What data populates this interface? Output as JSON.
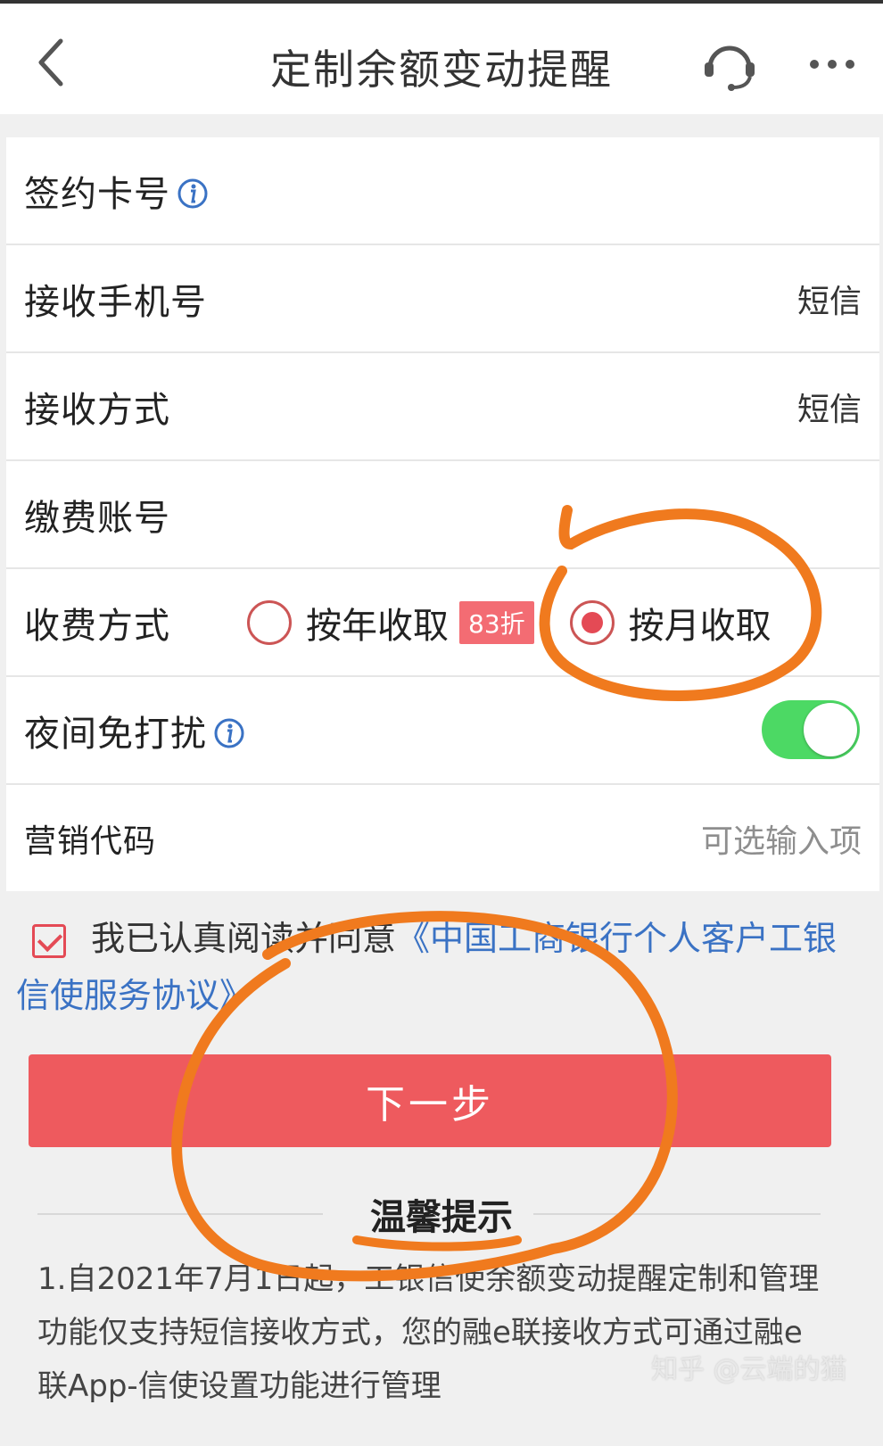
{
  "header": {
    "title": "定制余额变动提醒",
    "icons": [
      "back-icon",
      "headset-icon",
      "more-icon"
    ]
  },
  "form": {
    "card_number": {
      "label": "签约卡号"
    },
    "phone": {
      "label": "接收手机号",
      "value": "短信"
    },
    "receive_method": {
      "label": "接收方式",
      "value": "短信"
    },
    "fee_account": {
      "label": "缴费账号"
    },
    "fee_method": {
      "label": "收费方式",
      "options": [
        {
          "label": "按年收取",
          "badge": "83折",
          "selected": false
        },
        {
          "label": "按月收取",
          "selected": true
        }
      ]
    },
    "night_dnd": {
      "label": "夜间免打扰",
      "enabled": true
    },
    "marketing_code": {
      "label": "营销代码",
      "placeholder": "可选输入项"
    }
  },
  "agreement": {
    "checked": true,
    "text": "我已认真阅读并同意",
    "link": "《中国工商银行个人客户工银信使服务协议》"
  },
  "next_button": "下一步",
  "tips": {
    "title": "温馨提示",
    "body": "1.自2021年7月1日起，工银信使余额变动提醒定制和管理功能仅支持短信接收方式，您的融e联接收方式可通过融e联App-信使设置功能进行管理"
  },
  "watermark": "知乎 @云端的猫",
  "colors": {
    "accent_red": "#ee5a5e",
    "toggle_green": "#4cd964",
    "link_blue": "#3a72c4",
    "annotation_orange": "#f07a1e"
  }
}
